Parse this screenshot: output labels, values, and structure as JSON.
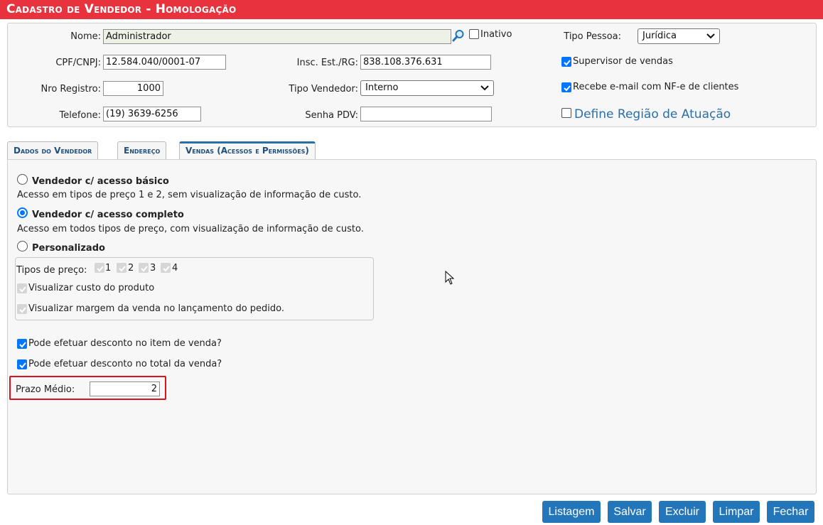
{
  "window": {
    "title": "Cadastro de Vendedor  - Homologação"
  },
  "header": {
    "nome": {
      "label": "Nome:",
      "value": "Administrador"
    },
    "inativo": {
      "label": "Inativo",
      "checked": false
    },
    "tipo_pessoa": {
      "label": "Tipo Pessoa:",
      "value": "Jurídica"
    },
    "cpf_cnpj": {
      "label": "CPF/CNPJ:",
      "value": "12.584.040/0001-07"
    },
    "insc_est": {
      "label": "Insc. Est./RG:",
      "value": "838.108.376.631"
    },
    "supervisor": {
      "label": "Supervisor de vendas",
      "checked": true
    },
    "nro_registro": {
      "label": "Nro Registro:",
      "value": "1000"
    },
    "tipo_vendedor": {
      "label": "Tipo Vendedor:",
      "value": "Interno"
    },
    "recebe_email": {
      "label": "Recebe e-mail com NF-e de clientes",
      "checked": true
    },
    "telefone": {
      "label": "Telefone:",
      "value": "(19) 3639-6256"
    },
    "senha_pdv": {
      "label": "Senha PDV:",
      "value": ""
    },
    "define_regiao": {
      "label": "Define Região de Atuação",
      "checked": false
    },
    "search_icon": "magnifier-icon"
  },
  "tabs": [
    {
      "label": "Dados do Vendedor",
      "active": false
    },
    {
      "label": "Endereço",
      "active": false
    },
    {
      "label": "Vendas (Acessos e Permissões)",
      "active": true
    }
  ],
  "vendas": {
    "basico": {
      "title": "Vendedor c/ acesso básico",
      "desc": "Acesso em tipos de preço 1 e 2, sem visualização de informação de custo.",
      "selected": false
    },
    "completo": {
      "title": "Vendedor c/ acesso completo",
      "desc": "Acesso em todos tipos de preço, com visualização de informação de custo.",
      "selected": true
    },
    "personalizado": {
      "title": "Personalizado",
      "selected": false
    },
    "tipos_preco": {
      "label": "Tipos de preço:",
      "options": [
        "1",
        "2",
        "3",
        "4"
      ]
    },
    "visualizar_custo": {
      "label": "Visualizar custo do produto"
    },
    "visualizar_margem": {
      "label": "Visualizar margem da venda no lançamento do pedido."
    },
    "desconto_item": {
      "label": "Pode efetuar desconto no item de venda?",
      "checked": true
    },
    "desconto_total": {
      "label": "Pode efetuar desconto no total da venda?",
      "checked": true
    },
    "prazo_medio": {
      "label": "Prazo Médio:",
      "value": "2"
    }
  },
  "buttons": {
    "listagem": "Listagem",
    "salvar": "Salvar",
    "excluir": "Excluir",
    "limpar": "Limpar",
    "fechar": "Fechar"
  },
  "colors": {
    "title_bar": "#e8323e",
    "button": "#2476ba",
    "checkbox": "#0075ff",
    "highlight": "#d9141c"
  }
}
